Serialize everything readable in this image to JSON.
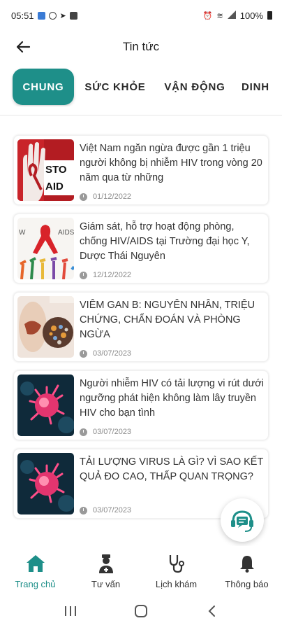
{
  "status_bar": {
    "time": "05:51",
    "battery": "100%"
  },
  "header": {
    "title": "Tin tức"
  },
  "tabs": [
    {
      "label": "CHUNG"
    },
    {
      "label": "SỨC KHỎE"
    },
    {
      "label": "VẬN ĐỘNG"
    },
    {
      "label": "DINH"
    }
  ],
  "news": [
    {
      "title": "Việt Nam ngăn ngừa được gần 1 triệu người không bị nhiễm HIV trong vòng 20 năm qua từ những",
      "date": "01/12/2022",
      "thumb_text": "STO AID"
    },
    {
      "title": "Giám sát, hỗ trợ hoạt động phòng, chống HIV/AIDS tại Trường đại học Y, Dược Thái Nguyên",
      "date": "12/12/2022",
      "thumb_text": "W AIDS"
    },
    {
      "title": "VIÊM GAN B: NGUYÊN NHÂN, TRIỆU CHỨNG, CHẨN ĐOÁN VÀ PHÒNG NGỪA",
      "date": "03/07/2023"
    },
    {
      "title": "Người nhiễm HIV có tải lượng vi rút dưới ngưỡng phát hiện không làm lây truyền HIV cho bạn tình",
      "date": "03/07/2023"
    },
    {
      "title": "TẢI LƯỢNG VIRUS LÀ GÌ? VÌ SAO KẾT QUẢ ĐO CAO, THẤP QUAN TRỌNG?",
      "date": "03/07/2023"
    }
  ],
  "bottom_nav": [
    {
      "label": "Trang chủ",
      "icon": "home-icon"
    },
    {
      "label": "Tư vấn",
      "icon": "doctor-icon"
    },
    {
      "label": "Lịch khám",
      "icon": "stethoscope-icon"
    },
    {
      "label": "Thông báo",
      "icon": "bell-icon"
    }
  ],
  "colors": {
    "accent": "#1e8f89",
    "text": "#333333",
    "muted": "#8a8a8a"
  }
}
